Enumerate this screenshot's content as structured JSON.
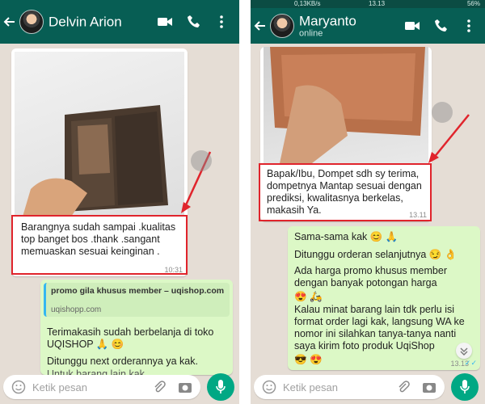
{
  "left": {
    "contact_name": "Delvin Arion",
    "incoming_text": "Barangnya sudah sampai .kualitas top banget bos .thank .sangant memuaskan sesuai keinginan .",
    "incoming_time": "10:31",
    "link_title": "promo gila khusus member – uqishop.com",
    "link_domain": "uqishopp.com",
    "reply_line1": "Terimakasih sudah berbelanja di toko UQISHOP 🙏 😊",
    "reply_line2": "Ditunggu next orderannya ya kak.",
    "reply_line3": "Untuk barang lain kak...",
    "input_placeholder": "Ketik pesan"
  },
  "right": {
    "status_left": "0,13KB/s",
    "status_time": "13.13",
    "status_battery": "56%",
    "contact_name": "Maryanto",
    "contact_status": "online",
    "incoming_text": "Bapak/Ibu, Dompet sdh sy terima, dompetnya Mantap sesuai dengan prediksi, kwalitasnya berkelas, makasih Ya.",
    "incoming_time": "13.11",
    "replies": [
      "Sama-sama kak 😊 🙏",
      "Ditunggu orderan selanjutnya 😏 👌",
      "Ada harga promo khusus member dengan banyak potongan harga",
      "😍 🛵",
      "Kalau minat barang lain tdk perlu isi format order lagi kak, langsung WA ke nomor ini silahkan tanya-tanya nanti saya kirim foto produk UqiShop",
      "😎 😍"
    ],
    "reply_time": "13.13",
    "input_placeholder": "Ketik pesan"
  },
  "colors": {
    "header": "#075e54",
    "chat_bg": "#e5ddd5",
    "outgoing": "#dcf8c6",
    "incoming": "#ffffff",
    "highlight": "#e0242c",
    "mic": "#00a884"
  }
}
